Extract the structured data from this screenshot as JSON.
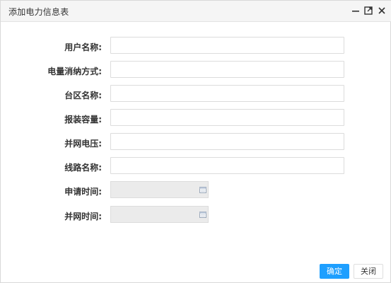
{
  "window": {
    "title": "添加电力信息表",
    "icons": {
      "minimize": "minimize-icon",
      "maximize": "maximize-icon",
      "close": "close-icon"
    }
  },
  "form": {
    "fields": [
      {
        "label": "用户名称:",
        "value": "",
        "type": "text"
      },
      {
        "label": "电量消纳方式:",
        "value": "",
        "type": "text"
      },
      {
        "label": "台区名称:",
        "value": "",
        "type": "text"
      },
      {
        "label": "报装容量:",
        "value": "",
        "type": "text"
      },
      {
        "label": "并网电压:",
        "value": "",
        "type": "text"
      },
      {
        "label": "线路名称:",
        "value": "",
        "type": "text"
      },
      {
        "label": "申请时间:",
        "value": "",
        "type": "date"
      },
      {
        "label": "并网时间:",
        "value": "",
        "type": "date"
      }
    ]
  },
  "buttons": {
    "confirm": "确定",
    "close": "关闭"
  },
  "colors": {
    "primary": "#1e9fff",
    "disabled_bg": "#ebebeb",
    "titlebar_bg": "#f5f5f5"
  }
}
